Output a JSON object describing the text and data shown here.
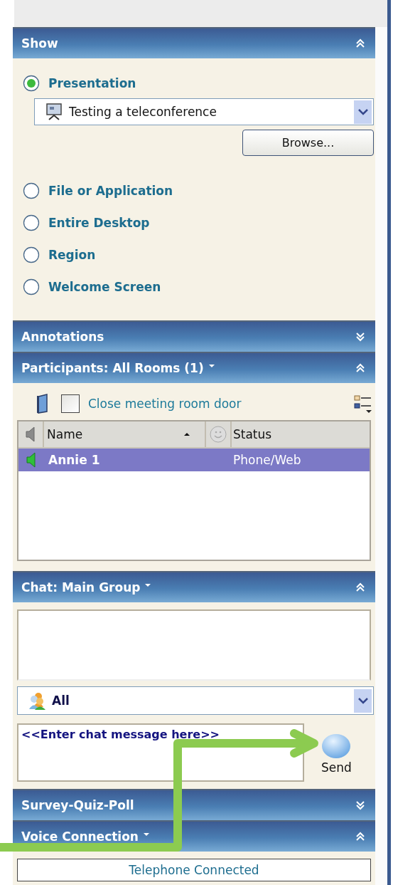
{
  "sections": [
    {
      "kind": "show",
      "title": "Show",
      "dropdown": false,
      "expanded": true,
      "presentation_select": {
        "value": "Testing a teleconference"
      },
      "browse_button": "Browse...",
      "options": [
        {
          "label": "Presentation",
          "selected": true
        },
        {
          "label": "File or Application",
          "selected": false
        },
        {
          "label": "Entire Desktop",
          "selected": false
        },
        {
          "label": "Region",
          "selected": false
        },
        {
          "label": "Welcome Screen",
          "selected": false
        }
      ]
    },
    {
      "kind": "collapsed",
      "title": "Annotations",
      "dropdown": false,
      "expanded": false
    },
    {
      "kind": "participants",
      "title": "Participants: All Rooms (1)",
      "dropdown": true,
      "expanded": true,
      "close_door": {
        "label": "Close meeting room door",
        "checked": false
      },
      "columns": [
        "Name",
        "Status"
      ],
      "rows": [
        {
          "name": "Annie 1",
          "status": "Phone/Web",
          "selected": true
        }
      ]
    },
    {
      "kind": "chat",
      "title": "Chat: Main Group",
      "dropdown": true,
      "expanded": true,
      "recipient": "All",
      "message_placeholder": "<<Enter chat message here>>",
      "send_button": "Send"
    },
    {
      "kind": "collapsed",
      "title": "Survey-Quiz-Poll",
      "dropdown": false,
      "expanded": false
    },
    {
      "kind": "voice",
      "title": "Voice Connection",
      "dropdown": true,
      "expanded": true,
      "status": "Telephone Connected"
    }
  ]
}
